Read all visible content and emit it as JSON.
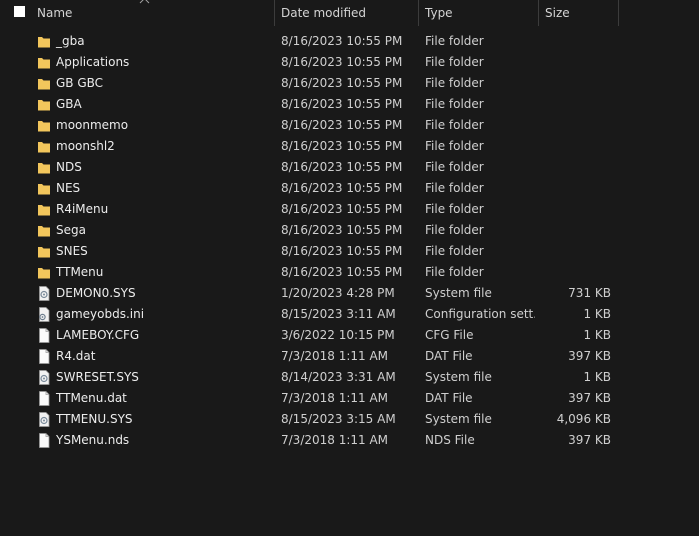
{
  "columns": {
    "name": "Name",
    "date_modified": "Date modified",
    "type": "Type",
    "size": "Size"
  },
  "colors": {
    "folder": "#f2c55c",
    "background": "#191919"
  },
  "files": [
    {
      "name": "_gba",
      "date": "8/16/2023 10:55 PM",
      "type": "File folder",
      "size": "",
      "icon": "folder-icon"
    },
    {
      "name": "Applications",
      "date": "8/16/2023 10:55 PM",
      "type": "File folder",
      "size": "",
      "icon": "folder-icon"
    },
    {
      "name": "GB GBC",
      "date": "8/16/2023 10:55 PM",
      "type": "File folder",
      "size": "",
      "icon": "folder-icon"
    },
    {
      "name": "GBA",
      "date": "8/16/2023 10:55 PM",
      "type": "File folder",
      "size": "",
      "icon": "folder-icon"
    },
    {
      "name": "moonmemo",
      "date": "8/16/2023 10:55 PM",
      "type": "File folder",
      "size": "",
      "icon": "folder-icon"
    },
    {
      "name": "moonshl2",
      "date": "8/16/2023 10:55 PM",
      "type": "File folder",
      "size": "",
      "icon": "folder-icon"
    },
    {
      "name": "NDS",
      "date": "8/16/2023 10:55 PM",
      "type": "File folder",
      "size": "",
      "icon": "folder-icon"
    },
    {
      "name": "NES",
      "date": "8/16/2023 10:55 PM",
      "type": "File folder",
      "size": "",
      "icon": "folder-icon"
    },
    {
      "name": "R4iMenu",
      "date": "8/16/2023 10:55 PM",
      "type": "File folder",
      "size": "",
      "icon": "folder-icon"
    },
    {
      "name": "Sega",
      "date": "8/16/2023 10:55 PM",
      "type": "File folder",
      "size": "",
      "icon": "folder-icon"
    },
    {
      "name": "SNES",
      "date": "8/16/2023 10:55 PM",
      "type": "File folder",
      "size": "",
      "icon": "folder-icon"
    },
    {
      "name": "TTMenu",
      "date": "8/16/2023 10:55 PM",
      "type": "File folder",
      "size": "",
      "icon": "folder-icon"
    },
    {
      "name": "DEMON0.SYS",
      "date": "1/20/2023 4:28 PM",
      "type": "System file",
      "size": "731 KB",
      "icon": "system-file-icon"
    },
    {
      "name": "gameyobds.ini",
      "date": "8/15/2023 3:11 AM",
      "type": "Configuration sett...",
      "size": "1 KB",
      "icon": "config-file-icon"
    },
    {
      "name": "LAMEBOY.CFG",
      "date": "3/6/2022 10:15 PM",
      "type": "CFG File",
      "size": "1 KB",
      "icon": "document-icon"
    },
    {
      "name": "R4.dat",
      "date": "7/3/2018 1:11 AM",
      "type": "DAT File",
      "size": "397 KB",
      "icon": "document-icon"
    },
    {
      "name": "SWRESET.SYS",
      "date": "8/14/2023 3:31 AM",
      "type": "System file",
      "size": "1 KB",
      "icon": "system-file-icon"
    },
    {
      "name": "TTMenu.dat",
      "date": "7/3/2018 1:11 AM",
      "type": "DAT File",
      "size": "397 KB",
      "icon": "document-icon"
    },
    {
      "name": "TTMENU.SYS",
      "date": "8/15/2023 3:15 AM",
      "type": "System file",
      "size": "4,096 KB",
      "icon": "system-file-icon"
    },
    {
      "name": "YSMenu.nds",
      "date": "7/3/2018 1:11 AM",
      "type": "NDS File",
      "size": "397 KB",
      "icon": "document-icon"
    }
  ]
}
